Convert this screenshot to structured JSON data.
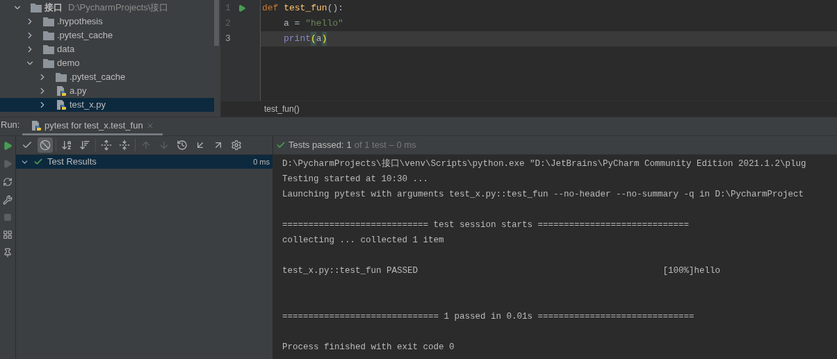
{
  "project_tree": {
    "items": [
      {
        "kind": "folder",
        "label": "接口",
        "path": "D:\\PycharmProjects\\接口",
        "expanded": true,
        "selected": false,
        "children": [
          {
            "kind": "folder",
            "label": ".hypothesis",
            "expanded": false,
            "selected": false
          },
          {
            "kind": "folder",
            "label": ".pytest_cache",
            "expanded": false,
            "selected": false
          },
          {
            "kind": "folder",
            "label": "data",
            "expanded": false,
            "selected": false
          },
          {
            "kind": "folder",
            "label": "demo",
            "expanded": true,
            "selected": false,
            "children": [
              {
                "kind": "folder",
                "label": ".pytest_cache",
                "expanded": false,
                "selected": false
              },
              {
                "kind": "python",
                "label": "a.py",
                "expanded": false,
                "selected": false
              },
              {
                "kind": "python",
                "label": "test_x.py",
                "expanded": false,
                "selected": true
              }
            ]
          }
        ]
      }
    ]
  },
  "editor": {
    "lines": [
      {
        "number": "1",
        "run": true,
        "current": false,
        "indented": false,
        "tokens": [
          {
            "kind": "keyword",
            "text": "def "
          },
          {
            "kind": "function",
            "text": "test_fun"
          },
          {
            "kind": "plain",
            "text": "():"
          }
        ]
      },
      {
        "number": "2",
        "run": false,
        "current": false,
        "indented": true,
        "tokens": [
          {
            "kind": "plain",
            "text": "a = "
          },
          {
            "kind": "string",
            "text": "\"hello\""
          }
        ]
      },
      {
        "number": "3",
        "run": false,
        "current": true,
        "indented": true,
        "tokens": [
          {
            "kind": "builtin",
            "text": "print"
          },
          {
            "kind": "match",
            "text": "("
          },
          {
            "kind": "plain",
            "text": "a"
          },
          {
            "kind": "match",
            "text": ")"
          }
        ]
      }
    ],
    "breadcrumb": "test_fun()"
  },
  "run_panel": {
    "label": "Run:",
    "tab": {
      "label": "pytest for test_x.test_fun",
      "selected": true
    },
    "side_tools": [
      {
        "kind": "rerun",
        "disabled": false
      },
      {
        "kind": "rerun-failed",
        "disabled": true
      },
      {
        "kind": "auto-test",
        "disabled": false
      },
      {
        "kind": "wrench",
        "disabled": false
      },
      {
        "kind": "stop",
        "disabled": true
      },
      {
        "kind": "layout",
        "disabled": false
      },
      {
        "kind": "pin",
        "disabled": false
      }
    ],
    "test_tools": [
      {
        "kind": "show-passed",
        "selected": false,
        "disabled": false
      },
      {
        "kind": "show-ignored",
        "selected": true,
        "disabled": false
      },
      {
        "kind": "sort-alpha",
        "selected": false,
        "disabled": false
      },
      {
        "kind": "sort-duration",
        "selected": false,
        "disabled": false
      },
      {
        "kind": "expand-all",
        "selected": false,
        "disabled": false
      },
      {
        "kind": "collapse-all",
        "selected": false,
        "disabled": false
      },
      {
        "kind": "previous",
        "selected": false,
        "disabled": true
      },
      {
        "kind": "next",
        "selected": false,
        "disabled": true
      },
      {
        "kind": "history",
        "selected": false,
        "disabled": false
      },
      {
        "kind": "import",
        "selected": false,
        "disabled": false
      },
      {
        "kind": "export",
        "selected": false,
        "disabled": false
      },
      {
        "kind": "settings",
        "selected": false,
        "disabled": false
      }
    ],
    "status": {
      "label": "Tests passed:",
      "count": "1",
      "detail": "of 1 test – 0 ms"
    },
    "results": [
      {
        "label": "Test Results",
        "time": "0 ms",
        "expanded": true,
        "selected": true
      }
    ],
    "console": [
      "D:\\PycharmProjects\\接口\\venv\\Scripts\\python.exe \"D:\\JetBrains\\PyCharm Community Edition 2021.1.2\\plug",
      "Testing started at 10:30 ...",
      "Launching pytest with arguments test_x.py::test_fun --no-header --no-summary -q in D:\\PycharmProject",
      "============================ test session starts =============================",
      "collecting ... collected 1 item",
      "test_x.py::test_fun PASSED                                               [100%]hello",
      "============================== 1 passed in 0.01s ==============================",
      "Process finished with exit code 0"
    ]
  }
}
